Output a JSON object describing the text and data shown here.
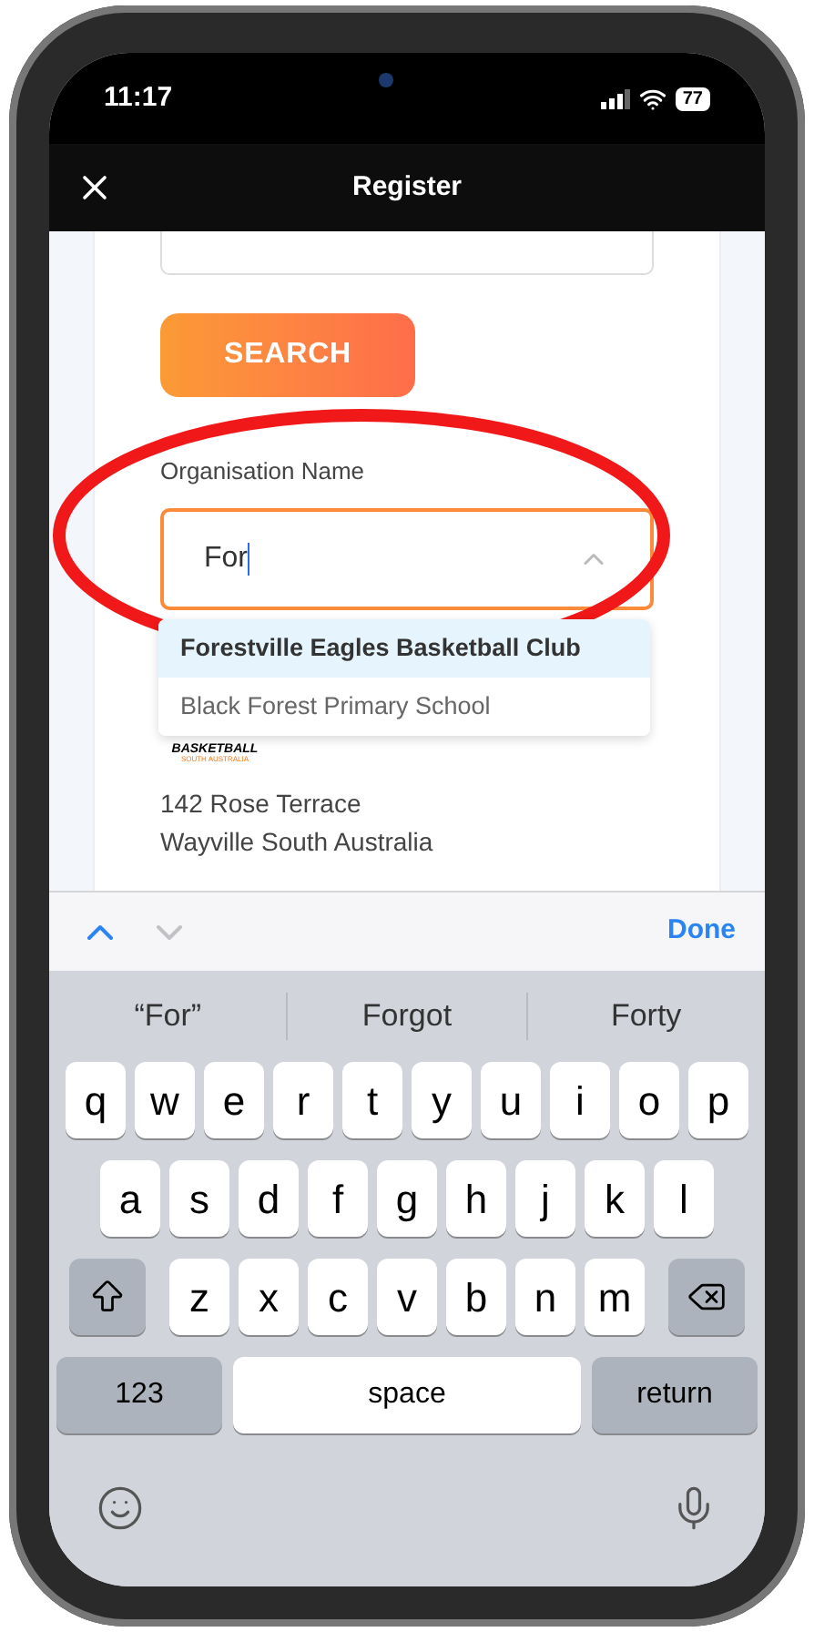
{
  "status_bar": {
    "time": "11:17",
    "battery": "77"
  },
  "header": {
    "title": "Register"
  },
  "search_button": {
    "label": "SEARCH"
  },
  "organisation": {
    "label": "Organisation Name",
    "value": "For",
    "expanded": true,
    "options": [
      {
        "label": "Forestville Eagles Basketball Club",
        "selected": true
      },
      {
        "label": "Black Forest Primary School",
        "selected": false
      }
    ]
  },
  "logo": {
    "text": "BASKETBALL",
    "subtext": "SOUTH AUSTRALIA"
  },
  "address": [
    "142 Rose Terrace",
    "Wayville South Australia"
  ],
  "accessory_bar": {
    "done": "Done"
  },
  "suggestions": [
    "“For”",
    "Forgot",
    "Forty"
  ],
  "keyboard": {
    "rows": [
      [
        {
          "kind": "key",
          "label": "q"
        },
        {
          "kind": "key",
          "label": "w"
        },
        {
          "kind": "key",
          "label": "e"
        },
        {
          "kind": "key",
          "label": "r"
        },
        {
          "kind": "key",
          "label": "t"
        },
        {
          "kind": "key",
          "label": "y"
        },
        {
          "kind": "key",
          "label": "u"
        },
        {
          "kind": "key",
          "label": "i"
        },
        {
          "kind": "key",
          "label": "o"
        },
        {
          "kind": "key",
          "label": "p"
        }
      ],
      [
        {
          "kind": "key",
          "label": "a"
        },
        {
          "kind": "key",
          "label": "s"
        },
        {
          "kind": "key",
          "label": "d"
        },
        {
          "kind": "key",
          "label": "f"
        },
        {
          "kind": "key",
          "label": "g"
        },
        {
          "kind": "key",
          "label": "h"
        },
        {
          "kind": "key",
          "label": "j"
        },
        {
          "kind": "key",
          "label": "k"
        },
        {
          "kind": "key",
          "label": "l"
        }
      ],
      [
        {
          "kind": "shift"
        },
        {
          "kind": "key",
          "label": "z"
        },
        {
          "kind": "key",
          "label": "x"
        },
        {
          "kind": "key",
          "label": "c"
        },
        {
          "kind": "key",
          "label": "v"
        },
        {
          "kind": "key",
          "label": "b"
        },
        {
          "kind": "key",
          "label": "n"
        },
        {
          "kind": "key",
          "label": "m"
        },
        {
          "kind": "backspace"
        }
      ]
    ],
    "bottom_keys": {
      "numbers": "123",
      "space": "space",
      "return": "return"
    }
  }
}
